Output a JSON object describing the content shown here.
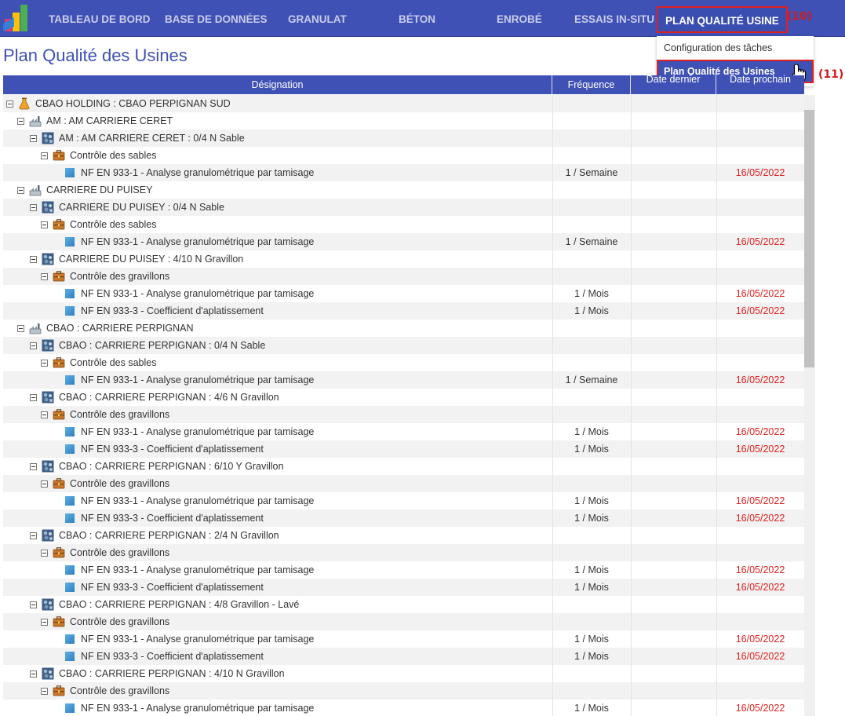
{
  "nav": {
    "items": [
      "TABLEAU DE BORD",
      "BASE DE DONNÉES",
      "GRANULAT",
      "BÉTON",
      "ENROBÉ",
      "ESSAIS IN-SITU",
      "PLAN QUALITÉ USINE"
    ],
    "active": "PLAN QUALITÉ USINE",
    "callout_active": "(10)"
  },
  "dropdown": {
    "items": [
      "Configuration des tâches",
      "Plan Qualité des Usines"
    ],
    "active": "Plan Qualité des Usines",
    "callout_active": "(11)"
  },
  "page": {
    "title": "Plan Qualité des Usines"
  },
  "table": {
    "columns": [
      "Désignation",
      "Fréquence",
      "Date dernier",
      "Date prochain"
    ],
    "rows": [
      {
        "level": 0,
        "type": "holding",
        "label": "CBAO HOLDING : CBAO PERPIGNAN SUD",
        "freq": "",
        "next": ""
      },
      {
        "level": 1,
        "type": "site",
        "label": "AM : AM CARRIERE CERET",
        "freq": "",
        "next": ""
      },
      {
        "level": 2,
        "type": "product",
        "label": "AM : AM CARRIERE CERET : 0/4 N Sable",
        "freq": "",
        "next": ""
      },
      {
        "level": 3,
        "type": "control",
        "label": "Contrôle des sables",
        "freq": "",
        "next": ""
      },
      {
        "level": 4,
        "type": "test",
        "label": "NF EN 933-1 - Analyse granulométrique par tamisage",
        "freq": "1 / Semaine",
        "next": "16/05/2022"
      },
      {
        "level": 1,
        "type": "site",
        "label": "CARRIERE DU PUISEY",
        "freq": "",
        "next": ""
      },
      {
        "level": 2,
        "type": "product",
        "label": "CARRIERE DU PUISEY : 0/4 N Sable",
        "freq": "",
        "next": ""
      },
      {
        "level": 3,
        "type": "control",
        "label": "Contrôle des sables",
        "freq": "",
        "next": ""
      },
      {
        "level": 4,
        "type": "test",
        "label": "NF EN 933-1 - Analyse granulométrique par tamisage",
        "freq": "1 / Semaine",
        "next": "16/05/2022"
      },
      {
        "level": 2,
        "type": "product",
        "label": "CARRIERE DU PUISEY : 4/10 N Gravillon",
        "freq": "",
        "next": ""
      },
      {
        "level": 3,
        "type": "control",
        "label": "Contrôle des gravillons",
        "freq": "",
        "next": ""
      },
      {
        "level": 4,
        "type": "test",
        "label": "NF EN 933-1 - Analyse granulométrique par tamisage",
        "freq": "1 / Mois",
        "next": "16/05/2022"
      },
      {
        "level": 4,
        "type": "test",
        "label": "NF EN 933-3 - Coefficient d'aplatissement",
        "freq": "1 / Mois",
        "next": "16/05/2022"
      },
      {
        "level": 1,
        "type": "site",
        "label": "CBAO : CARRIERE PERPIGNAN",
        "freq": "",
        "next": ""
      },
      {
        "level": 2,
        "type": "product",
        "label": "CBAO : CARRIERE PERPIGNAN : 0/4 N Sable",
        "freq": "",
        "next": ""
      },
      {
        "level": 3,
        "type": "control",
        "label": "Contrôle des sables",
        "freq": "",
        "next": ""
      },
      {
        "level": 4,
        "type": "test",
        "label": "NF EN 933-1 - Analyse granulométrique par tamisage",
        "freq": "1 / Semaine",
        "next": "16/05/2022"
      },
      {
        "level": 2,
        "type": "product",
        "label": "CBAO : CARRIERE PERPIGNAN : 4/6 N Gravillon",
        "freq": "",
        "next": ""
      },
      {
        "level": 3,
        "type": "control",
        "label": "Contrôle des gravillons",
        "freq": "",
        "next": ""
      },
      {
        "level": 4,
        "type": "test",
        "label": "NF EN 933-1 - Analyse granulométrique par tamisage",
        "freq": "1 / Mois",
        "next": "16/05/2022"
      },
      {
        "level": 4,
        "type": "test",
        "label": "NF EN 933-3 - Coefficient d'aplatissement",
        "freq": "1 / Mois",
        "next": "16/05/2022"
      },
      {
        "level": 2,
        "type": "product",
        "label": "CBAO : CARRIERE PERPIGNAN : 6/10 Y Gravillon",
        "freq": "",
        "next": ""
      },
      {
        "level": 3,
        "type": "control",
        "label": "Contrôle des gravillons",
        "freq": "",
        "next": ""
      },
      {
        "level": 4,
        "type": "test",
        "label": "NF EN 933-1 - Analyse granulométrique par tamisage",
        "freq": "1 / Mois",
        "next": "16/05/2022"
      },
      {
        "level": 4,
        "type": "test",
        "label": "NF EN 933-3 - Coefficient d'aplatissement",
        "freq": "1 / Mois",
        "next": "16/05/2022"
      },
      {
        "level": 2,
        "type": "product",
        "label": "CBAO : CARRIERE PERPIGNAN : 2/4 N Gravillon",
        "freq": "",
        "next": ""
      },
      {
        "level": 3,
        "type": "control",
        "label": "Contrôle des gravillons",
        "freq": "",
        "next": ""
      },
      {
        "level": 4,
        "type": "test",
        "label": "NF EN 933-1 - Analyse granulométrique par tamisage",
        "freq": "1 / Mois",
        "next": "16/05/2022"
      },
      {
        "level": 4,
        "type": "test",
        "label": "NF EN 933-3 - Coefficient d'aplatissement",
        "freq": "1 / Mois",
        "next": "16/05/2022"
      },
      {
        "level": 2,
        "type": "product",
        "label": "CBAO : CARRIERE PERPIGNAN : 4/8 Gravillon - Lavé",
        "freq": "",
        "next": ""
      },
      {
        "level": 3,
        "type": "control",
        "label": "Contrôle des gravillons",
        "freq": "",
        "next": ""
      },
      {
        "level": 4,
        "type": "test",
        "label": "NF EN 933-1 - Analyse granulométrique par tamisage",
        "freq": "1 / Mois",
        "next": "16/05/2022"
      },
      {
        "level": 4,
        "type": "test",
        "label": "NF EN 933-3 - Coefficient d'aplatissement",
        "freq": "1 / Mois",
        "next": "16/05/2022"
      },
      {
        "level": 2,
        "type": "product",
        "label": "CBAO : CARRIERE PERPIGNAN : 4/10 N Gravillon",
        "freq": "",
        "next": ""
      },
      {
        "level": 3,
        "type": "control",
        "label": "Contrôle des gravillons",
        "freq": "",
        "next": ""
      },
      {
        "level": 4,
        "type": "test",
        "label": "NF EN 933-1 - Analyse granulométrique par tamisage",
        "freq": "1 / Mois",
        "next": "16/05/2022"
      }
    ]
  },
  "colors": {
    "primary": "#3f51b5",
    "date_next": "#e02020",
    "callout": "#d01c1c"
  }
}
